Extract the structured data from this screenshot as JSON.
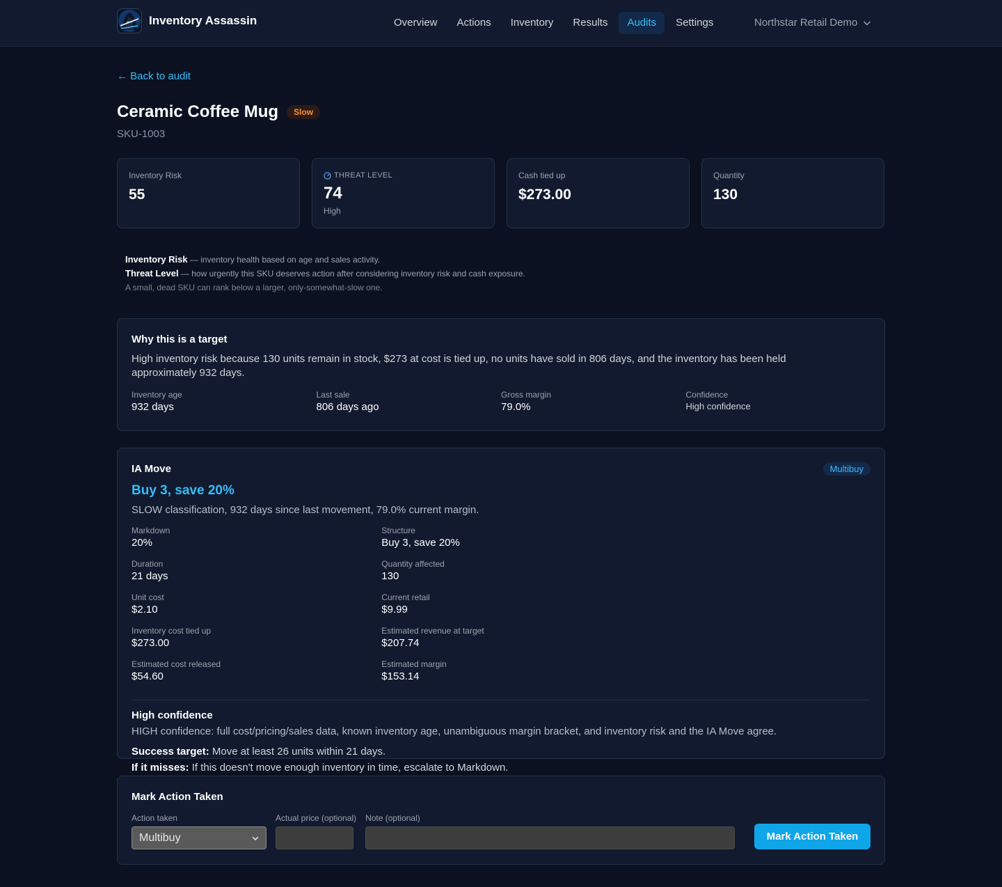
{
  "app": {
    "brand_name": "Inventory Assassin"
  },
  "nav": {
    "items": [
      {
        "label": "Overview"
      },
      {
        "label": "Actions"
      },
      {
        "label": "Inventory"
      },
      {
        "label": "Results"
      },
      {
        "label": "Audits",
        "active": true
      },
      {
        "label": "Settings"
      }
    ],
    "org_name": "Northstar Retail Demo"
  },
  "page": {
    "back_label": "← Back to audit",
    "title": "Ceramic Coffee Mug",
    "status_badge": "Slow",
    "sku": "SKU-1003"
  },
  "stats": {
    "inventory_risk": {
      "label": "Inventory Risk",
      "value": "55"
    },
    "threat_level": {
      "label": "THREAT LEVEL",
      "value": "74",
      "sub": "High"
    },
    "cash_tied_up": {
      "label": "Cash tied up",
      "value": "$273.00"
    },
    "quantity": {
      "label": "Quantity",
      "value": "130"
    }
  },
  "legend": {
    "risk_term": "Inventory Risk",
    "risk_desc": " — inventory health based on age and sales activity.",
    "threat_term": "Threat Level",
    "threat_desc": " — how urgently this SKU deserves action after considering inventory risk and cash exposure.",
    "note": "A small, dead SKU can rank below a larger, only-somewhat-slow one."
  },
  "why": {
    "title": "Why this is a target",
    "text": "High inventory risk because 130 units remain in stock, $273 at cost is tied up, no units have sold in 806 days, and the inventory has been held approximately 932 days.",
    "metrics": [
      {
        "label": "Inventory age",
        "value": "932 days"
      },
      {
        "label": "Last sale",
        "value": "806 days ago"
      },
      {
        "label": "Gross margin",
        "value": "79.0%"
      },
      {
        "label": "Confidence",
        "value": "High confidence"
      }
    ]
  },
  "move": {
    "title": "IA Move",
    "badge": "Multibuy",
    "headline": "Buy 3, save 20%",
    "description": "SLOW classification, 932 days since last movement, 79.0% current margin.",
    "details": [
      {
        "label": "Markdown",
        "value": "20%"
      },
      {
        "label": "Structure",
        "value": "Buy 3, save 20%"
      },
      {
        "label": "Duration",
        "value": "21 days"
      },
      {
        "label": "Quantity affected",
        "value": "130"
      },
      {
        "label": "Unit cost",
        "value": "$2.10"
      },
      {
        "label": "Current retail",
        "value": "$9.99"
      },
      {
        "label": "Inventory cost tied up",
        "value": "$273.00"
      },
      {
        "label": "Estimated revenue at target",
        "value": "$207.74"
      },
      {
        "label": "Estimated cost released",
        "value": "$54.60"
      },
      {
        "label": "Estimated margin",
        "value": "$153.14"
      }
    ],
    "confidence_title": "High confidence",
    "confidence_text": "HIGH confidence: full cost/pricing/sales data, known inventory age, unambiguous margin bracket, and inventory risk and the IA Move agree.",
    "success_label": "Success target:",
    "success_text": " Move at least 26 units within 21 days.",
    "miss_label": "If it misses:",
    "miss_text": " If this doesn't move enough inventory in time, escalate to Markdown."
  },
  "action_form": {
    "title": "Mark Action Taken",
    "action_label": "Action taken",
    "action_value": "Multibuy",
    "price_label": "Actual price (optional)",
    "price_value": "",
    "note_label": "Note (optional)",
    "note_value": "",
    "submit_label": "Mark Action Taken"
  },
  "colors": {
    "background": "#0b1120",
    "surface": "#111a2e",
    "accent": "#38bdf8",
    "primary_button": "#0ea5e9",
    "slow_badge": "#fb923c"
  },
  "icons": {
    "logo": "hooded-assassin-logo",
    "org_dropdown": "chevron-down-icon",
    "threat": "gauge-icon"
  }
}
